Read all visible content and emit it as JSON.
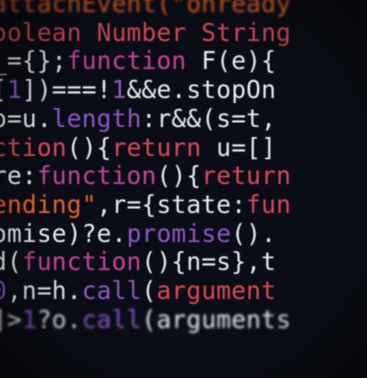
{
  "colors": {
    "white": "#e8eaf2",
    "orange": "#e8642c",
    "purple": "#8e57c7",
    "cyan": "#52c7e8",
    "red": "#d94a5a",
    "magenta": "#c5449a",
    "yellow": "#e8c86a",
    "brown": "#c8763a"
  },
  "lines": [
    [
      {
        "t": "attachEvent(",
        "c": "orange"
      },
      {
        "t": "\"onready",
        "c": "orange"
      }
    ],
    [
      {
        "t": "oolean Number String",
        "c": "red"
      }
    ],
    [
      {
        "t": "_={};",
        "c": "white"
      },
      {
        "t": "function ",
        "c": "magenta"
      },
      {
        "t": "F(e){",
        "c": "white"
      }
    ],
    [
      {
        "t": "[",
        "c": "white"
      },
      {
        "t": "1",
        "c": "purple"
      },
      {
        "t": "])===!",
        "c": "white"
      },
      {
        "t": "1",
        "c": "purple"
      },
      {
        "t": "&&e.stopOn",
        "c": "white"
      }
    ],
    [
      {
        "t": "o=u.",
        "c": "white"
      },
      {
        "t": "length",
        "c": "purple"
      },
      {
        "t": ":r&&(s=t,",
        "c": "white"
      }
    ],
    [
      {
        "t": "ction",
        "c": "red"
      },
      {
        "t": "(){",
        "c": "white"
      },
      {
        "t": "return ",
        "c": "red"
      },
      {
        "t": "u=[]",
        "c": "white"
      }
    ],
    [
      {
        "t": "re:",
        "c": "white"
      },
      {
        "t": "function",
        "c": "magenta"
      },
      {
        "t": "(){",
        "c": "white"
      },
      {
        "t": "return",
        "c": "red"
      }
    ],
    [
      {
        "t": "ending\"",
        "c": "orange"
      },
      {
        "t": ",r={state:",
        "c": "white"
      },
      {
        "t": "fun",
        "c": "red"
      }
    ],
    [
      {
        "t": "omise)?e.",
        "c": "white"
      },
      {
        "t": "promise",
        "c": "purple"
      },
      {
        "t": "().",
        "c": "white"
      }
    ],
    [
      {
        "t": "d(",
        "c": "white"
      },
      {
        "t": "function",
        "c": "magenta"
      },
      {
        "t": "(){n=s},t",
        "c": "white"
      }
    ],
    [
      {
        "t": "0",
        "c": "purple"
      },
      {
        "t": ",n=h.",
        "c": "white"
      },
      {
        "t": "call",
        "c": "purple"
      },
      {
        "t": "(",
        "c": "white"
      },
      {
        "t": "argument",
        "c": "red"
      }
    ],
    [
      {
        "t": "]>",
        "c": "white"
      },
      {
        "t": "1",
        "c": "purple"
      },
      {
        "t": "?o.",
        "c": "white"
      },
      {
        "t": "call",
        "c": "purple"
      },
      {
        "t": "(arguments",
        "c": "white"
      }
    ]
  ]
}
